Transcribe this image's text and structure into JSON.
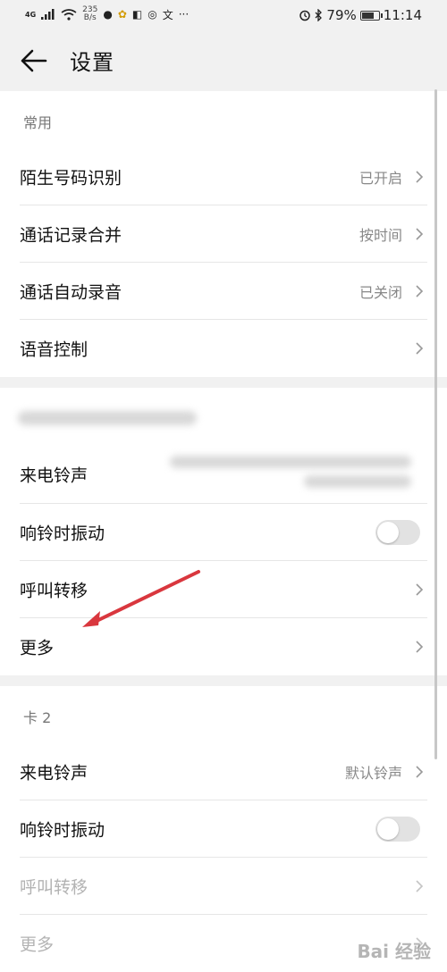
{
  "status_bar": {
    "network": "4G",
    "speed_value": "235",
    "speed_unit": "B/s",
    "battery": "79%",
    "battery_level": 0.79,
    "time": "11:14"
  },
  "header": {
    "title": "设置"
  },
  "sections": [
    {
      "title": "常用",
      "items": [
        {
          "label": "陌生号码识别",
          "value": "已开启"
        },
        {
          "label": "通话记录合并",
          "value": "按时间"
        },
        {
          "label": "通话自动录音",
          "value": "已关闭"
        },
        {
          "label": "语音控制",
          "value": ""
        }
      ]
    },
    {
      "title": "",
      "items": [
        {
          "label": "来电铃声",
          "value": ""
        },
        {
          "label": "响铃时振动",
          "toggle": false
        },
        {
          "label": "呼叫转移"
        },
        {
          "label": "更多"
        }
      ]
    },
    {
      "title": "卡 2",
      "items": [
        {
          "label": "来电铃声",
          "value": "默认铃声"
        },
        {
          "label": "响铃时振动",
          "toggle": false
        },
        {
          "label": "呼叫转移",
          "disabled": true
        },
        {
          "label": "更多",
          "disabled": true
        }
      ]
    }
  ],
  "icons": {
    "back": "arrow-left-icon",
    "chevron": "chevron-right-icon",
    "alarm": "alarm-icon",
    "bluetooth": "bluetooth-icon"
  },
  "colors": {
    "annotation_arrow": "#d9373e"
  },
  "watermark": "Bai 经验"
}
